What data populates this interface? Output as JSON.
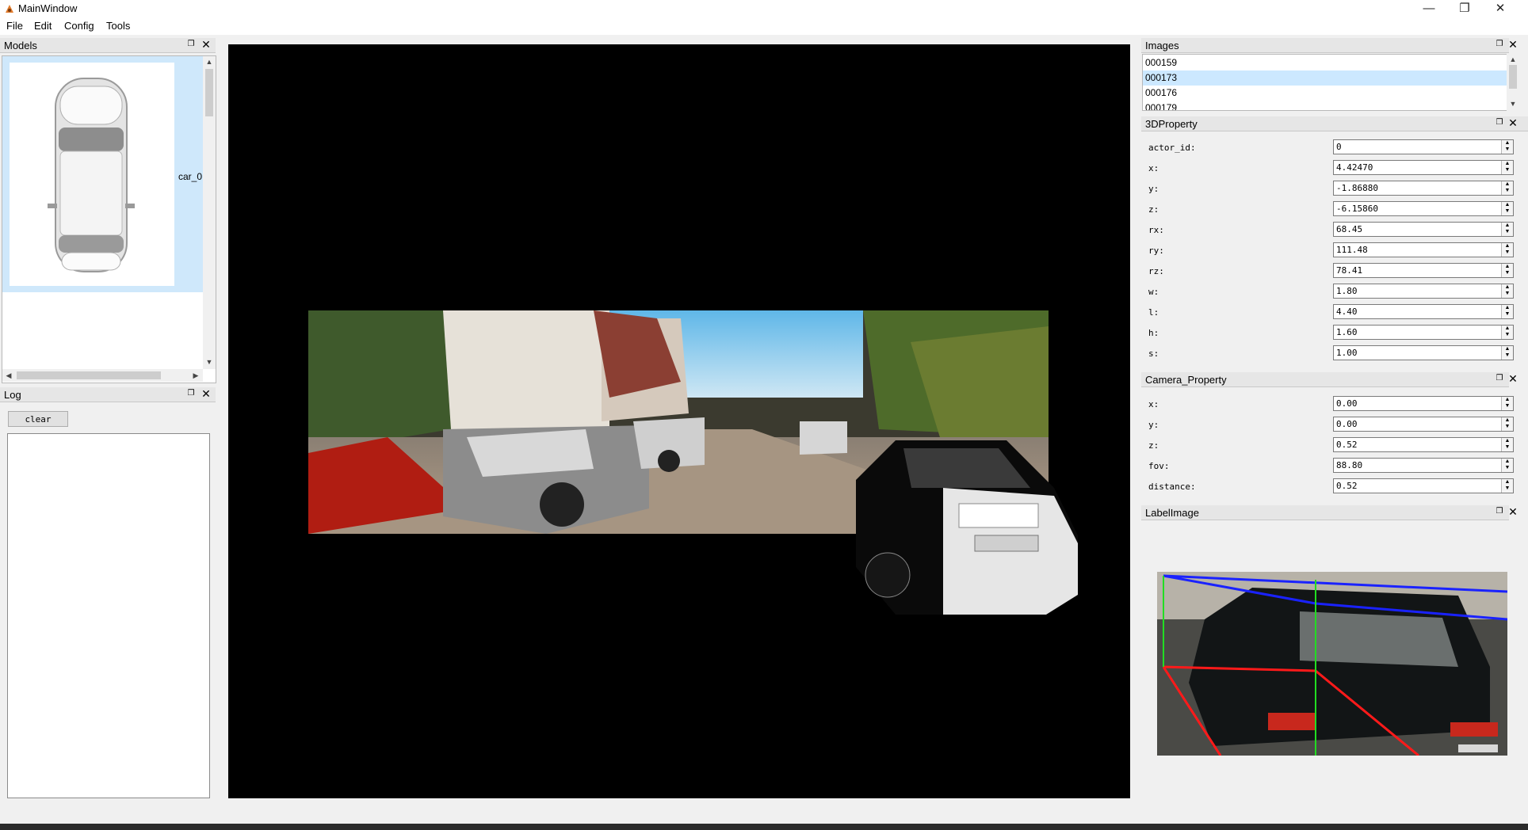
{
  "window": {
    "title": "MainWindow"
  },
  "menu": [
    "File",
    "Edit",
    "Config",
    "Tools"
  ],
  "models": {
    "title": "Models",
    "items": [
      {
        "label": "car_0"
      }
    ]
  },
  "log": {
    "title": "Log",
    "clear_label": "clear"
  },
  "images": {
    "title": "Images",
    "items": [
      "000159",
      "000173",
      "000176",
      "000179"
    ],
    "selected": "000173"
  },
  "property3d": {
    "title": "3DProperty",
    "fields": [
      {
        "label": "actor_id:",
        "value": "0"
      },
      {
        "label": "x:",
        "value": "4.42470"
      },
      {
        "label": "y:",
        "value": "-1.86880"
      },
      {
        "label": "z:",
        "value": "-6.15860"
      },
      {
        "label": "rx:",
        "value": "68.45"
      },
      {
        "label": "ry:",
        "value": "111.48"
      },
      {
        "label": "rz:",
        "value": "78.41"
      },
      {
        "label": "w:",
        "value": "1.80"
      },
      {
        "label": "l:",
        "value": "4.40"
      },
      {
        "label": "h:",
        "value": "1.60"
      },
      {
        "label": "s:",
        "value": "1.00"
      }
    ]
  },
  "camera": {
    "title": "Camera_Property",
    "fields": [
      {
        "label": "x:",
        "value": "0.00"
      },
      {
        "label": "y:",
        "value": "0.00"
      },
      {
        "label": "z:",
        "value": "0.52"
      },
      {
        "label": "fov:",
        "value": "88.80"
      },
      {
        "label": "distance:",
        "value": "0.52"
      }
    ]
  },
  "label_image": {
    "title": "LabelImage"
  },
  "colors": {
    "selection": "#cce8ff",
    "box_top": "#1a22ff",
    "box_bottom": "#ff1a1a",
    "box_vertical": "#22dd22"
  }
}
